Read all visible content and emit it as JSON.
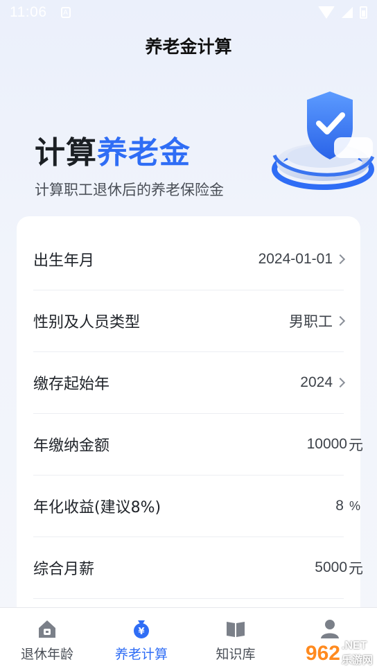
{
  "status_bar": {
    "time": "11:06",
    "app_glyph": "A"
  },
  "nav": {
    "title": "养老金计算"
  },
  "hero": {
    "title_plain": "计算",
    "title_accent": "养老金",
    "subtitle": "计算职工退休后的养老保险金"
  },
  "form": {
    "rows": [
      {
        "label": "出生年月",
        "value": "2024-01-01",
        "unit": ""
      },
      {
        "label": "性别及人员类型",
        "value": "男职工",
        "unit": ""
      },
      {
        "label": "缴存起始年",
        "value": "2024",
        "unit": ""
      },
      {
        "label": "年缴纳金额",
        "value": "10000",
        "unit": "元"
      },
      {
        "label": "年化收益(建议8%)",
        "value": "8",
        "unit": "%"
      },
      {
        "label": "综合月薪",
        "value": "5000",
        "unit": "元"
      }
    ]
  },
  "tabs": [
    {
      "label": "退休年龄",
      "icon": "house-icon",
      "active": false
    },
    {
      "label": "养老计算",
      "icon": "money-bag-icon",
      "active": true
    },
    {
      "label": "知识库",
      "icon": "book-icon",
      "active": false
    },
    {
      "label": "",
      "icon": "user-icon",
      "active": false
    }
  ],
  "watermark": {
    "number": "962",
    "suffix": ".NET",
    "name": "乐游网"
  },
  "colors": {
    "accent": "#2f6df5",
    "text": "#1f2329",
    "background": "#eef2fb"
  }
}
